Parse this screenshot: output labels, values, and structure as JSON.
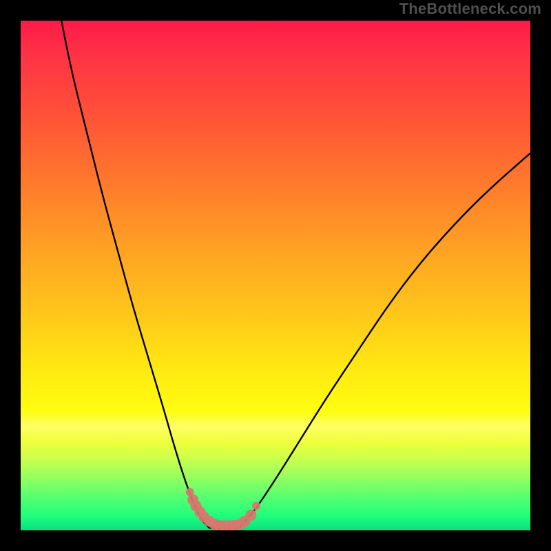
{
  "watermark_text": "TheBottleneck.com",
  "chart_data": {
    "type": "line",
    "title": "",
    "xlabel": "",
    "ylabel": "",
    "xlim": [
      0,
      100
    ],
    "ylim": [
      0,
      100
    ],
    "grid": false,
    "legend": false,
    "note": "Two black bottleneck curves descending to a minimum near x≈36–42 (bottleneck ≈0%) then rising; salmon dotted markers cluster at the valley floor.",
    "series": [
      {
        "name": "left-curve",
        "color": "#000000",
        "x": [
          8,
          10,
          13,
          16,
          19,
          22,
          25,
          28,
          30,
          32,
          34,
          35.5,
          37
        ],
        "y": [
          100,
          90,
          78,
          66,
          55,
          44,
          34,
          24,
          17,
          10.5,
          5,
          2,
          0.5
        ]
      },
      {
        "name": "valley-floor",
        "color": "#000000",
        "x": [
          37,
          39,
          41,
          43
        ],
        "y": [
          0.5,
          0.3,
          0.3,
          0.6
        ]
      },
      {
        "name": "right-curve",
        "color": "#000000",
        "x": [
          43,
          46,
          50,
          55,
          60,
          66,
          72,
          78,
          85,
          92,
          100
        ],
        "y": [
          0.6,
          4,
          10,
          18,
          26,
          35,
          44,
          52,
          60,
          67,
          74
        ]
      },
      {
        "name": "marker-dots",
        "color": "#d9766d",
        "style": "dots",
        "x": [
          33.2,
          33.8,
          34.4,
          35.2,
          36.0,
          37.0,
          38.0,
          39.0,
          40.0,
          41.0,
          42.0,
          43.0,
          44.0,
          45.2,
          46.2
        ],
        "y": [
          7.5,
          6.0,
          4.8,
          3.6,
          2.6,
          1.8,
          1.2,
          0.9,
          0.9,
          0.9,
          1.0,
          1.2,
          1.8,
          3.0,
          4.8
        ]
      }
    ],
    "gradient_stops": [
      {
        "pct": 0,
        "color": "#ff1a49"
      },
      {
        "pct": 18,
        "color": "#ff5038"
      },
      {
        "pct": 45,
        "color": "#ffa223"
      },
      {
        "pct": 68,
        "color": "#ffe812"
      },
      {
        "pct": 86,
        "color": "#c9ff4e"
      },
      {
        "pct": 100,
        "color": "#08e081"
      }
    ]
  }
}
